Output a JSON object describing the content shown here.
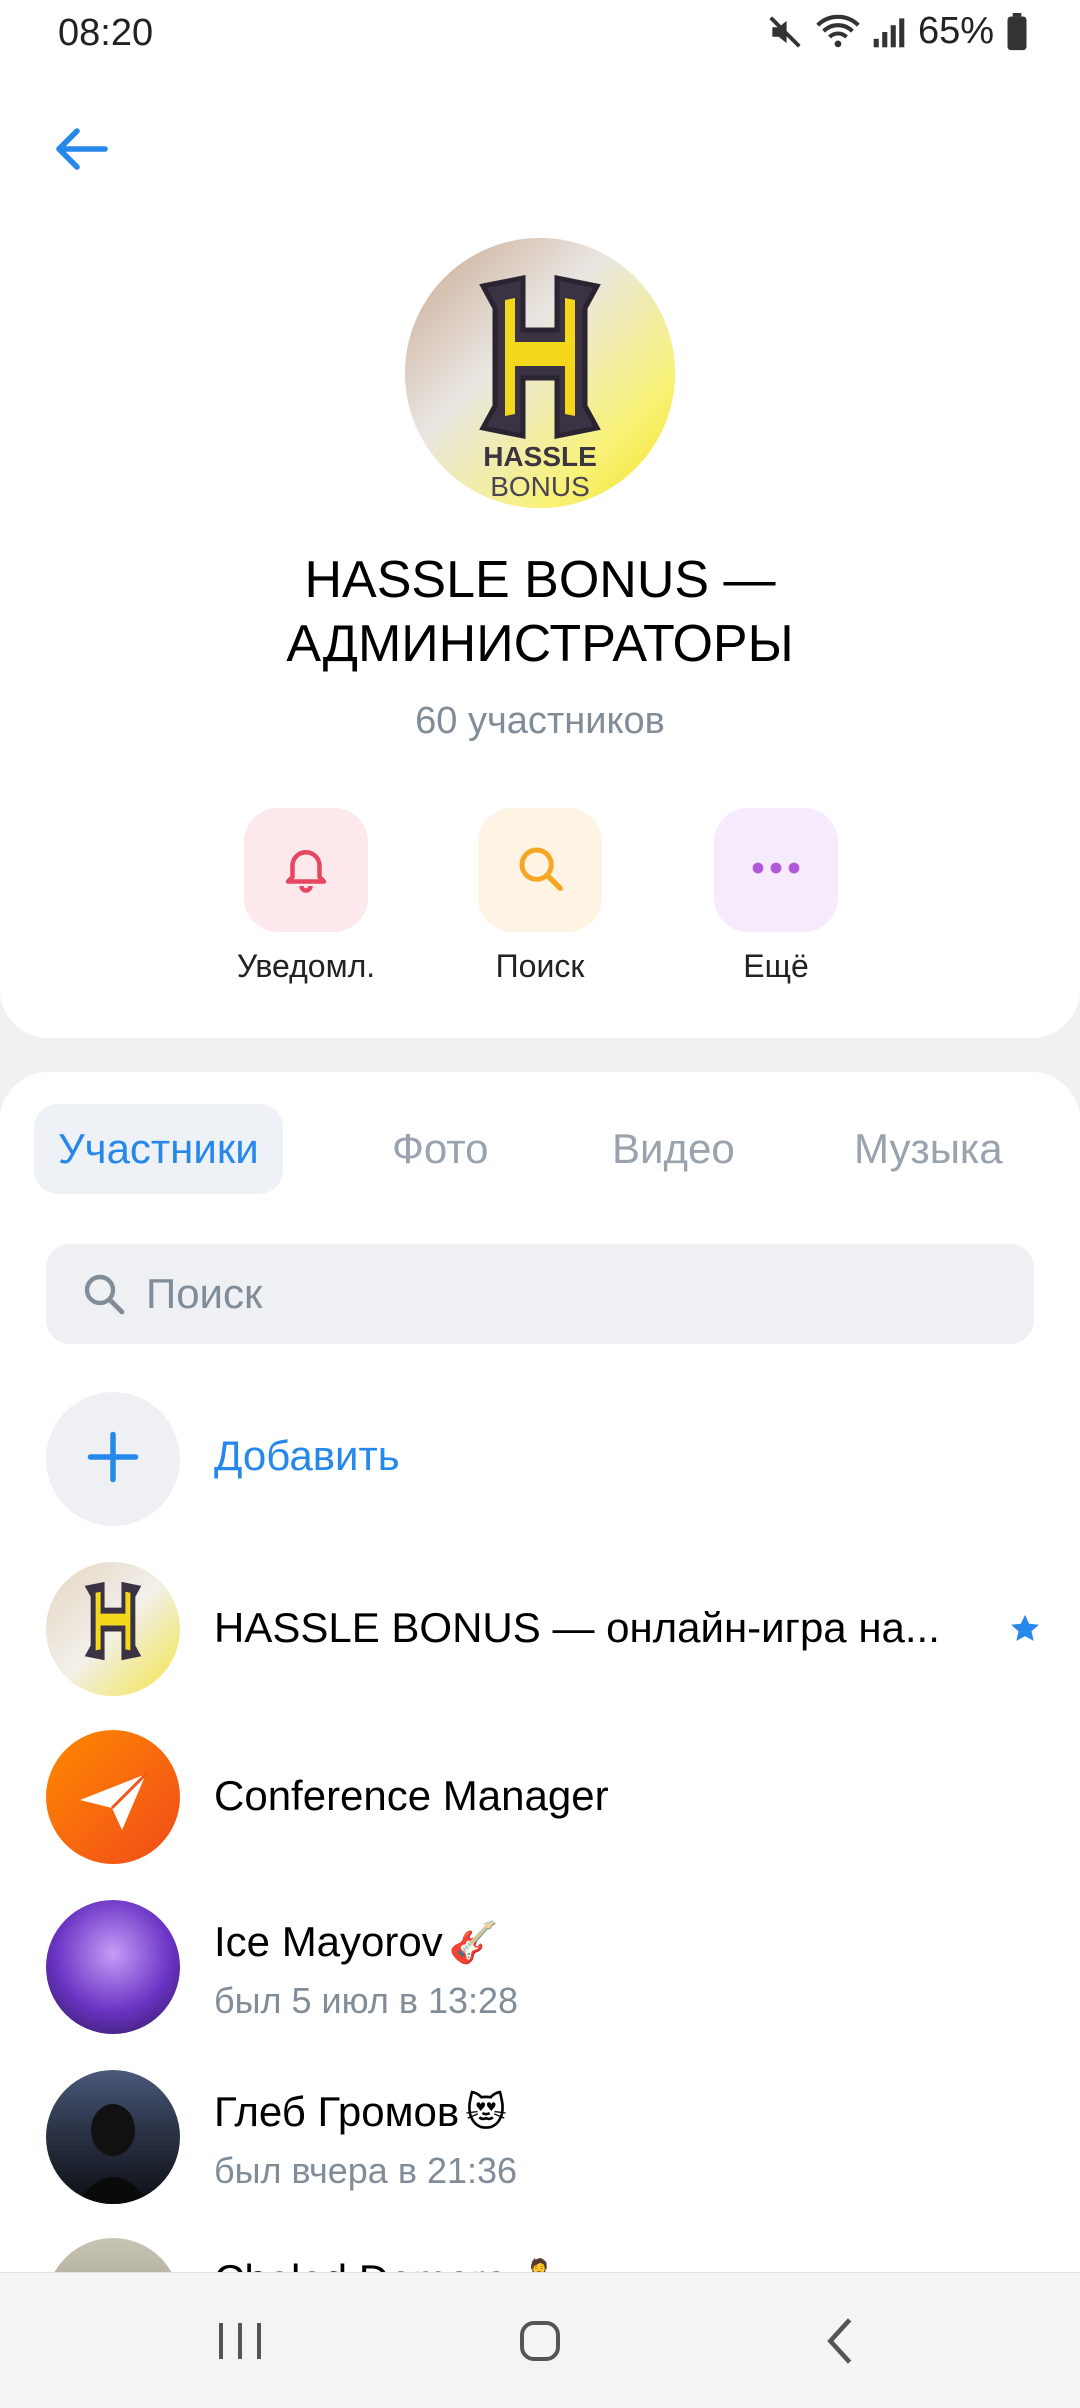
{
  "status_bar": {
    "time": "08:20",
    "battery": "65%",
    "icons": [
      "mute-icon",
      "wifi-icon",
      "signal-icon",
      "battery-icon"
    ]
  },
  "header": {
    "back_icon": "arrow-left-icon"
  },
  "group": {
    "title_line1": "HASSLE BONUS —",
    "title_line2": "АДМИНИСТРАТОРЫ",
    "members": "60 участников",
    "avatar_text_top": "HASSLE",
    "avatar_text_bottom": "BONUS"
  },
  "actions": [
    {
      "label": "Уведомл.",
      "icon": "bell-icon",
      "bg": "#fde9ec",
      "fg": "#e64660"
    },
    {
      "label": "Поиск",
      "icon": "search-icon",
      "bg": "#fff4e3",
      "fg": "#f5a623"
    },
    {
      "label": "Ещё",
      "icon": "more-icon",
      "bg": "#f6ebfd",
      "fg": "#b15ad9"
    }
  ],
  "tabs": [
    {
      "label": "Участники"
    },
    {
      "label": "Фото"
    },
    {
      "label": "Видео"
    },
    {
      "label": "Музыка"
    }
  ],
  "search": {
    "placeholder": "Поиск"
  },
  "add": {
    "label": "Добавить"
  },
  "members": [
    {
      "name": "HASSLE BONUS — онлайн-игра на...",
      "status": "",
      "emoji": "",
      "star": true
    },
    {
      "name": "Conference Manager",
      "status": "",
      "emoji": "",
      "star": false
    },
    {
      "name": "Ice Mayorov",
      "status": "был 5 июл в 13:28",
      "emoji": "🎸",
      "star": false
    },
    {
      "name": "Глеб Громов",
      "status": "был вчера в 21:36",
      "emoji": "😻",
      "star": false
    },
    {
      "name": "Cholod Demora",
      "status": "",
      "emoji": "🧘",
      "star": false
    }
  ],
  "colors": {
    "accent": "#2688eb",
    "secondary_text": "#818c99",
    "background": "#f0f1f3"
  }
}
